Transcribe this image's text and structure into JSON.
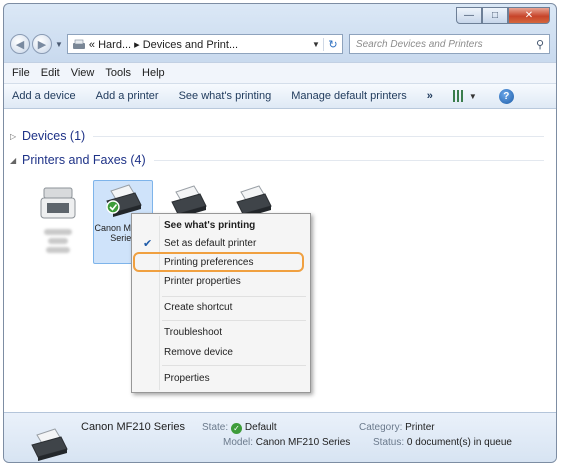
{
  "window": {
    "controls": {
      "minimize": "—",
      "maximize": "□",
      "close": "✕"
    },
    "address": {
      "crumbs": "« Hard... ▸ Devices and Print...",
      "search_placeholder": "Search Devices and Printers"
    }
  },
  "menubar": [
    "File",
    "Edit",
    "View",
    "Tools",
    "Help"
  ],
  "toolbar": {
    "add_device": "Add a device",
    "add_printer": "Add a printer",
    "see_printing": "See what's printing",
    "manage_default": "Manage default printers",
    "more": "»"
  },
  "groups": {
    "devices": "Devices (1)",
    "printers": "Printers and Faxes (4)"
  },
  "printers": {
    "selected_label": "Canon MF210 Series"
  },
  "context_menu": {
    "items": [
      {
        "label": "See what's printing",
        "bold": true
      },
      {
        "label": "Set as default printer",
        "checked": true
      },
      {
        "label": "Printing preferences",
        "highlighted": true
      },
      {
        "label": "Printer properties"
      },
      {
        "label": "Create shortcut"
      },
      {
        "label": "Troubleshoot"
      },
      {
        "label": "Remove device"
      },
      {
        "label": "Properties"
      }
    ]
  },
  "details": {
    "name": "Canon MF210 Series",
    "state_label": "State:",
    "state_value": "Default",
    "model_label": "Model:",
    "model_value": "Canon MF210 Series",
    "category_label": "Category:",
    "category_value": "Printer",
    "status_label": "Status:",
    "status_value": "0 document(s) in queue"
  },
  "colors": {
    "highlight_outline": "#f0a040",
    "selection": "#cfe3fa",
    "group_text": "#1e3287"
  }
}
